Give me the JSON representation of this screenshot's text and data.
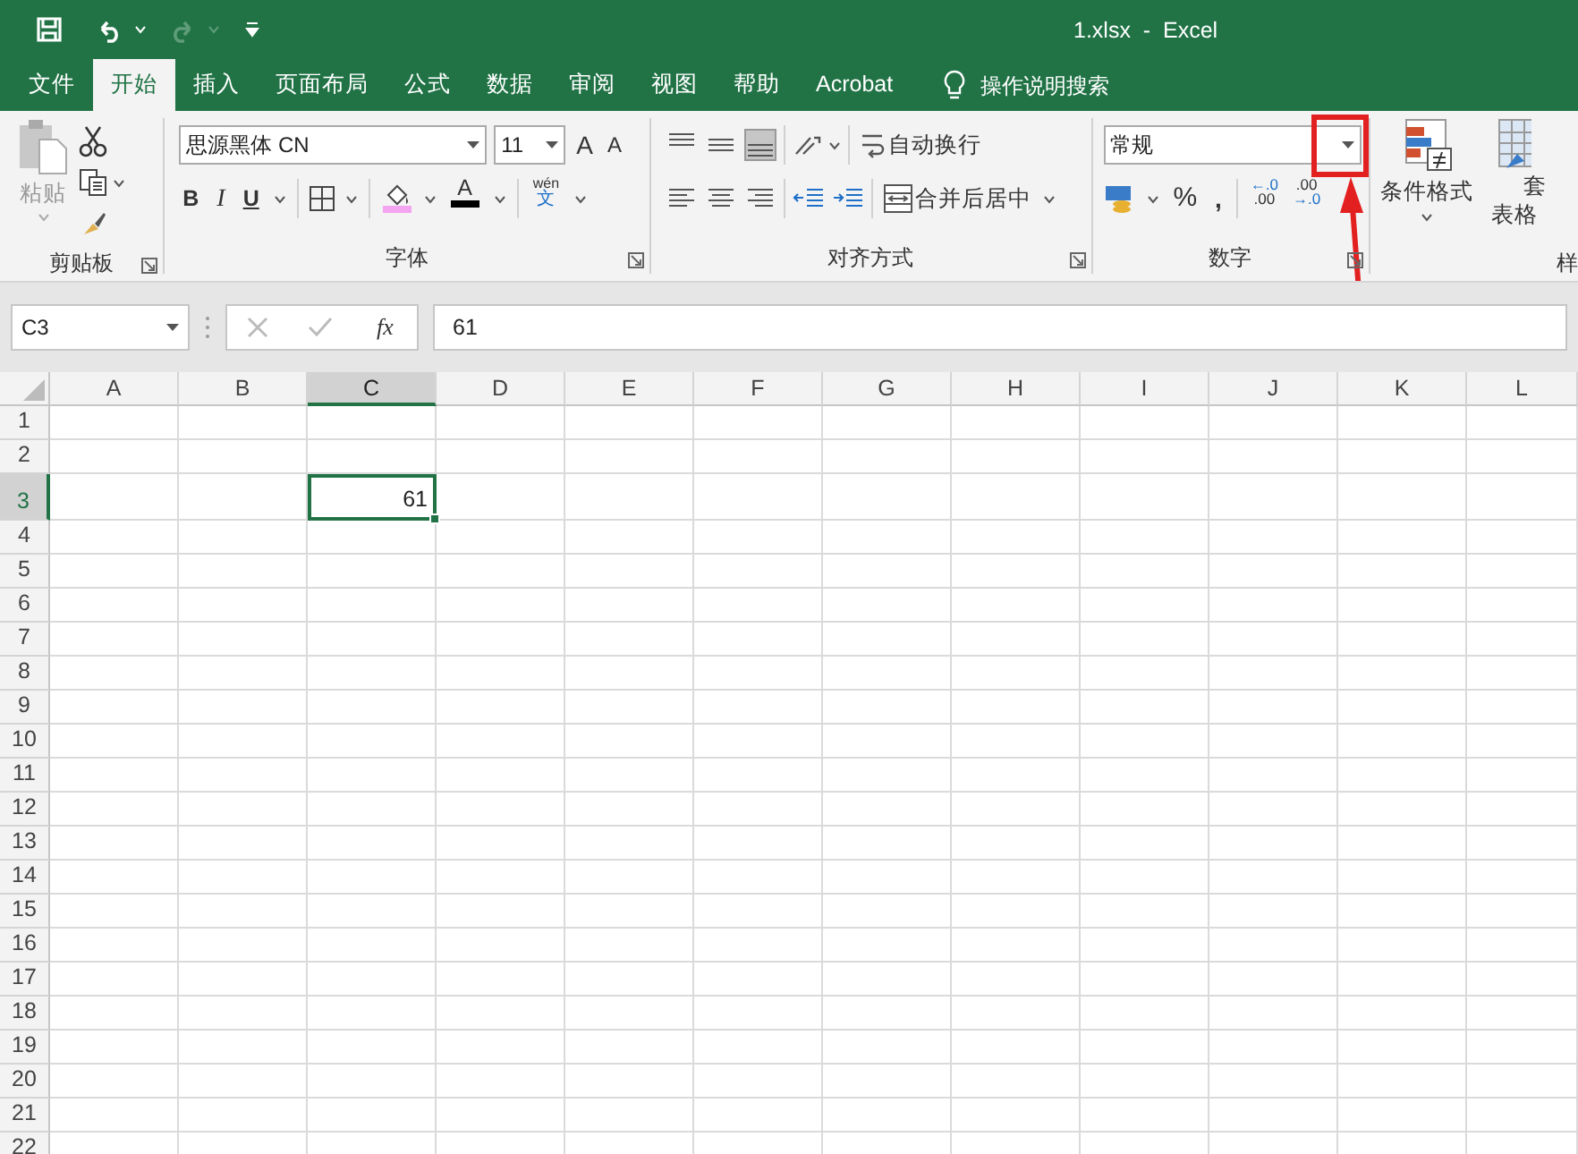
{
  "title_bar": {
    "title": "1.xlsx  -  Excel"
  },
  "menu_tabs": [
    {
      "label": "文件",
      "selected": false
    },
    {
      "label": "开始",
      "selected": true
    },
    {
      "label": "插入",
      "selected": false
    },
    {
      "label": "页面布局",
      "selected": false
    },
    {
      "label": "公式",
      "selected": false
    },
    {
      "label": "数据",
      "selected": false
    },
    {
      "label": "审阅",
      "selected": false
    },
    {
      "label": "视图",
      "selected": false
    },
    {
      "label": "帮助",
      "selected": false
    },
    {
      "label": "Acrobat",
      "selected": false
    }
  ],
  "tell_me": "操作说明搜索",
  "ribbon": {
    "clipboard": {
      "paste": "粘贴",
      "group_label": "剪贴板"
    },
    "font": {
      "font_name": "思源黑体 CN",
      "font_size": "11",
      "grow": "A",
      "shrink": "A",
      "bold": "B",
      "italic": "I",
      "underline": "U",
      "font_color": "A",
      "phonetic_top": "wén",
      "phonetic_bottom": "文",
      "group_label": "字体"
    },
    "alignment": {
      "wrap_text": "自动换行",
      "merge": "合并后居中",
      "group_label": "对齐方式"
    },
    "number": {
      "format": "常规",
      "percent": "%",
      "comma": ",",
      "increase_decimal": [
        "←.0",
        ".00"
      ],
      "decrease_decimal": [
        ".00",
        "→.0"
      ],
      "group_label": "数字"
    },
    "styles": {
      "conditional_format": "条件格式",
      "table_format": [
        "套",
        "表格"
      ],
      "group_label": "样"
    }
  },
  "formula_bar": {
    "name_box": "C3",
    "fx": "fx",
    "value": "61"
  },
  "sheet": {
    "columns": [
      {
        "label": "A",
        "selected": false
      },
      {
        "label": "B",
        "selected": false
      },
      {
        "label": "C",
        "selected": true
      },
      {
        "label": "D",
        "selected": false
      },
      {
        "label": "E",
        "selected": false
      },
      {
        "label": "F",
        "selected": false
      },
      {
        "label": "G",
        "selected": false
      },
      {
        "label": "H",
        "selected": false
      },
      {
        "label": "I",
        "selected": false
      },
      {
        "label": "J",
        "selected": false
      },
      {
        "label": "K",
        "selected": false
      },
      {
        "label": "L",
        "selected": false
      }
    ],
    "rows": [
      {
        "label": "1",
        "selected": false
      },
      {
        "label": "2",
        "selected": false
      },
      {
        "label": "3",
        "selected": true
      },
      {
        "label": "4",
        "selected": false
      },
      {
        "label": "5",
        "selected": false
      },
      {
        "label": "6",
        "selected": false
      },
      {
        "label": "7",
        "selected": false
      },
      {
        "label": "8",
        "selected": false
      },
      {
        "label": "9",
        "selected": false
      },
      {
        "label": "10",
        "selected": false
      },
      {
        "label": "11",
        "selected": false
      },
      {
        "label": "12",
        "selected": false
      },
      {
        "label": "13",
        "selected": false
      },
      {
        "label": "14",
        "selected": false
      },
      {
        "label": "15",
        "selected": false
      },
      {
        "label": "16",
        "selected": false
      },
      {
        "label": "17",
        "selected": false
      },
      {
        "label": "18",
        "selected": false
      },
      {
        "label": "19",
        "selected": false
      },
      {
        "label": "20",
        "selected": false
      },
      {
        "label": "21",
        "selected": false
      },
      {
        "label": "22",
        "selected": false
      }
    ],
    "cell_rows": [
      [],
      [],
      [
        null,
        null,
        "61"
      ]
    ]
  },
  "annotation": {
    "kind": "box-with-arrow"
  }
}
